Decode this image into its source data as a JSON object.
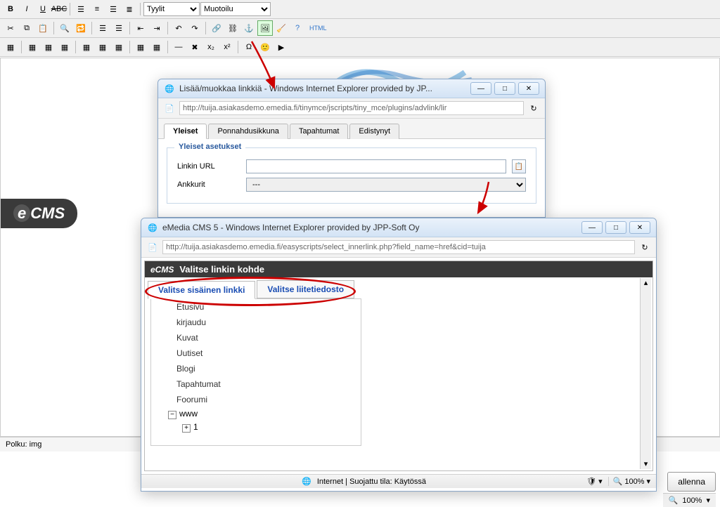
{
  "toolbar": {
    "styles_label": "Tyylit",
    "format_label": "Muotoilu",
    "html_label": "HTML"
  },
  "status": {
    "path": "Polku: img"
  },
  "bottom": {
    "save": "allenna",
    "zoom": "100%"
  },
  "dialog1": {
    "title": "Lisää/muokkaa linkkiä - Windows Internet Explorer provided by JP...",
    "url": "http://tuija.asiakasdemo.emedia.fi/tinymce/jscripts/tiny_mce/plugins/advlink/lir",
    "tabs": [
      "Yleiset",
      "Ponnahdusikkuna",
      "Tapahtumat",
      "Edistynyt"
    ],
    "legend": "Yleiset asetukset",
    "url_label": "Linkin URL",
    "anchor_label": "Ankkurit",
    "anchor_value": "---"
  },
  "dialog2": {
    "title": "eMedia CMS 5 - Windows Internet Explorer provided by JPP-Soft Oy",
    "url": "http://tuija.asiakasdemo.emedia.fi/easyscripts/select_innerlink.php?field_name=href&cid=tuija",
    "header": "Valitse linkin kohde",
    "tab1": "Valitse sisäinen linkki",
    "tab2": "Valitse liitetiedosto",
    "items": [
      "Etusivu",
      "kirjaudu",
      "Kuvat",
      "Uutiset",
      "Blogi",
      "Tapahtumat",
      "Foorumi"
    ],
    "group": "www",
    "child": "1",
    "status": "Internet | Suojattu tila: Käytössä",
    "zoom": "100%"
  },
  "logo": "CMS"
}
